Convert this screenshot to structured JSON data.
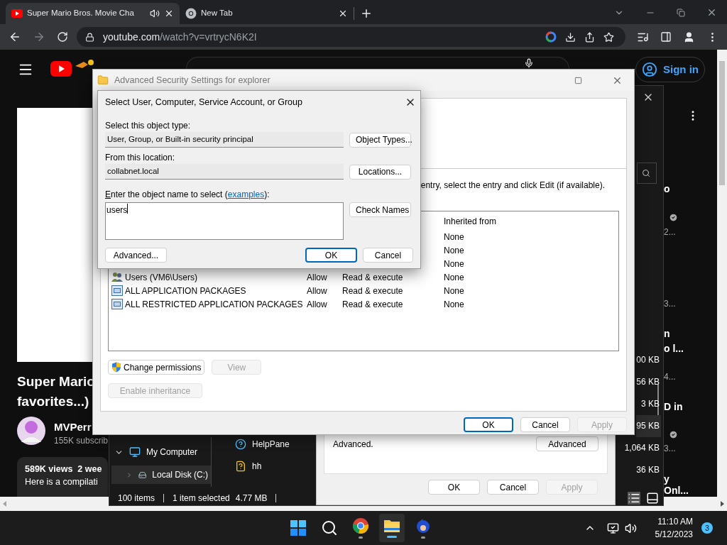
{
  "browser": {
    "tabs": [
      {
        "title": "Super Mario Bros. Movie Cha",
        "playing_audio": true,
        "selected": true
      },
      {
        "title": "New Tab",
        "playing_audio": false,
        "selected": false
      }
    ],
    "url_host": "youtube.com",
    "url_path": "/watch?v=vrtrycN6K2I"
  },
  "youtube": {
    "sign_in": "Sign in",
    "video_title_lines": [
      "Super Mario",
      "favorites...)"
    ],
    "channel": "MVPerr",
    "subscribers": "155K subscrib",
    "stats": "589K views  2 wee",
    "description": "Here is a compilati",
    "side_fragments": [
      {
        "kind": "title",
        "text": "o"
      },
      {
        "kind": "verified"
      },
      {
        "kind": "meta",
        "text": "2..."
      },
      {
        "kind": "meta",
        "text": "3..."
      },
      {
        "kind": "title",
        "text": "n"
      },
      {
        "kind": "title",
        "text": "o l..."
      },
      {
        "kind": "meta",
        "text": "4..."
      },
      {
        "kind": "title",
        "text": "D in"
      },
      {
        "kind": "verified"
      },
      {
        "kind": "meta",
        "text": "3..."
      },
      {
        "kind": "title",
        "text": "y"
      },
      {
        "kind": "title",
        "text": "Onl..."
      }
    ]
  },
  "explorer": {
    "nav": [
      {
        "label": "My Computer",
        "expanded": true,
        "selected": false,
        "children": [
          {
            "label": "Local Disk (C:)",
            "expanded": false,
            "selected": true
          }
        ]
      }
    ],
    "files": [
      {
        "name": "HelpPane",
        "kind": "help"
      },
      {
        "name": "hh",
        "kind": "help-file"
      }
    ],
    "sizes": [
      {
        "text": "00 KB",
        "selected": false
      },
      {
        "text": "56 KB",
        "selected": false
      },
      {
        "text": "3 KB",
        "selected": false
      },
      {
        "text": "95 KB",
        "selected": true
      },
      {
        "text": "1,064 KB",
        "selected": false
      },
      {
        "text": "36 KB",
        "selected": false
      }
    ],
    "status": {
      "items": "100 items",
      "selection": "1 item selected",
      "size": "4.77 MB"
    }
  },
  "properties": {
    "note": "Advanced.",
    "advanced_button": "Advanced",
    "buttons": [
      {
        "label": "OK",
        "disabled": false
      },
      {
        "label": "Cancel",
        "disabled": false
      },
      {
        "label": "Apply",
        "disabled": true
      }
    ]
  },
  "advanced": {
    "title": "Advanced Security Settings for explorer",
    "instruction": "entry, select the entry and click Edit (if available).",
    "inherited_header": "Inherited from",
    "entries": [
      {
        "inherited": "None"
      },
      {
        "inherited": "None"
      },
      {
        "inherited": "None"
      },
      {
        "principal": "Users (VM6\\Users)",
        "kind": "group",
        "type": "Allow",
        "access": "Read & execute",
        "inherited": "None"
      },
      {
        "principal": "ALL APPLICATION PACKAGES",
        "kind": "package",
        "type": "Allow",
        "access": "Read & execute",
        "inherited": "None"
      },
      {
        "principal": "ALL RESTRICTED APPLICATION PACKAGES",
        "kind": "package",
        "type": "Allow",
        "access": "Read & execute",
        "inherited": "None"
      }
    ],
    "change_permissions": "Change permissions",
    "view": {
      "label": "View",
      "disabled": true
    },
    "enable_inheritance": {
      "label": "Enable inheritance",
      "disabled": true
    },
    "footer": [
      {
        "label": "OK",
        "disabled": false,
        "default": true
      },
      {
        "label": "Cancel",
        "disabled": false,
        "default": false
      },
      {
        "label": "Apply",
        "disabled": true,
        "default": false
      }
    ]
  },
  "select": {
    "title": "Select User, Computer, Service Account, or Group",
    "object_type_label": "Select this object type:",
    "object_type": "User, Group, or Built-in security principal",
    "object_types_button": "Object Types...",
    "location_label": "From this location:",
    "location": "collabnet.local",
    "locations_button": "Locations...",
    "name_label": "Enter the object name to select (",
    "examples_link": "examples",
    "name_label_end": "):",
    "name_value": "users",
    "check_names_button": "Check Names",
    "advanced_button": "Advanced...",
    "ok": "OK",
    "cancel": "Cancel"
  },
  "taskbar": {
    "apps": [
      {
        "kind": "start",
        "running": false,
        "selected": false
      },
      {
        "kind": "search",
        "running": false,
        "selected": false
      },
      {
        "kind": "browser",
        "running": true,
        "selected": false
      },
      {
        "kind": "files",
        "running": true,
        "selected": true
      },
      {
        "kind": "game",
        "running": true,
        "selected": false
      }
    ],
    "time": "11:10 AM",
    "date": "5/12/2023",
    "notifications": "3"
  }
}
